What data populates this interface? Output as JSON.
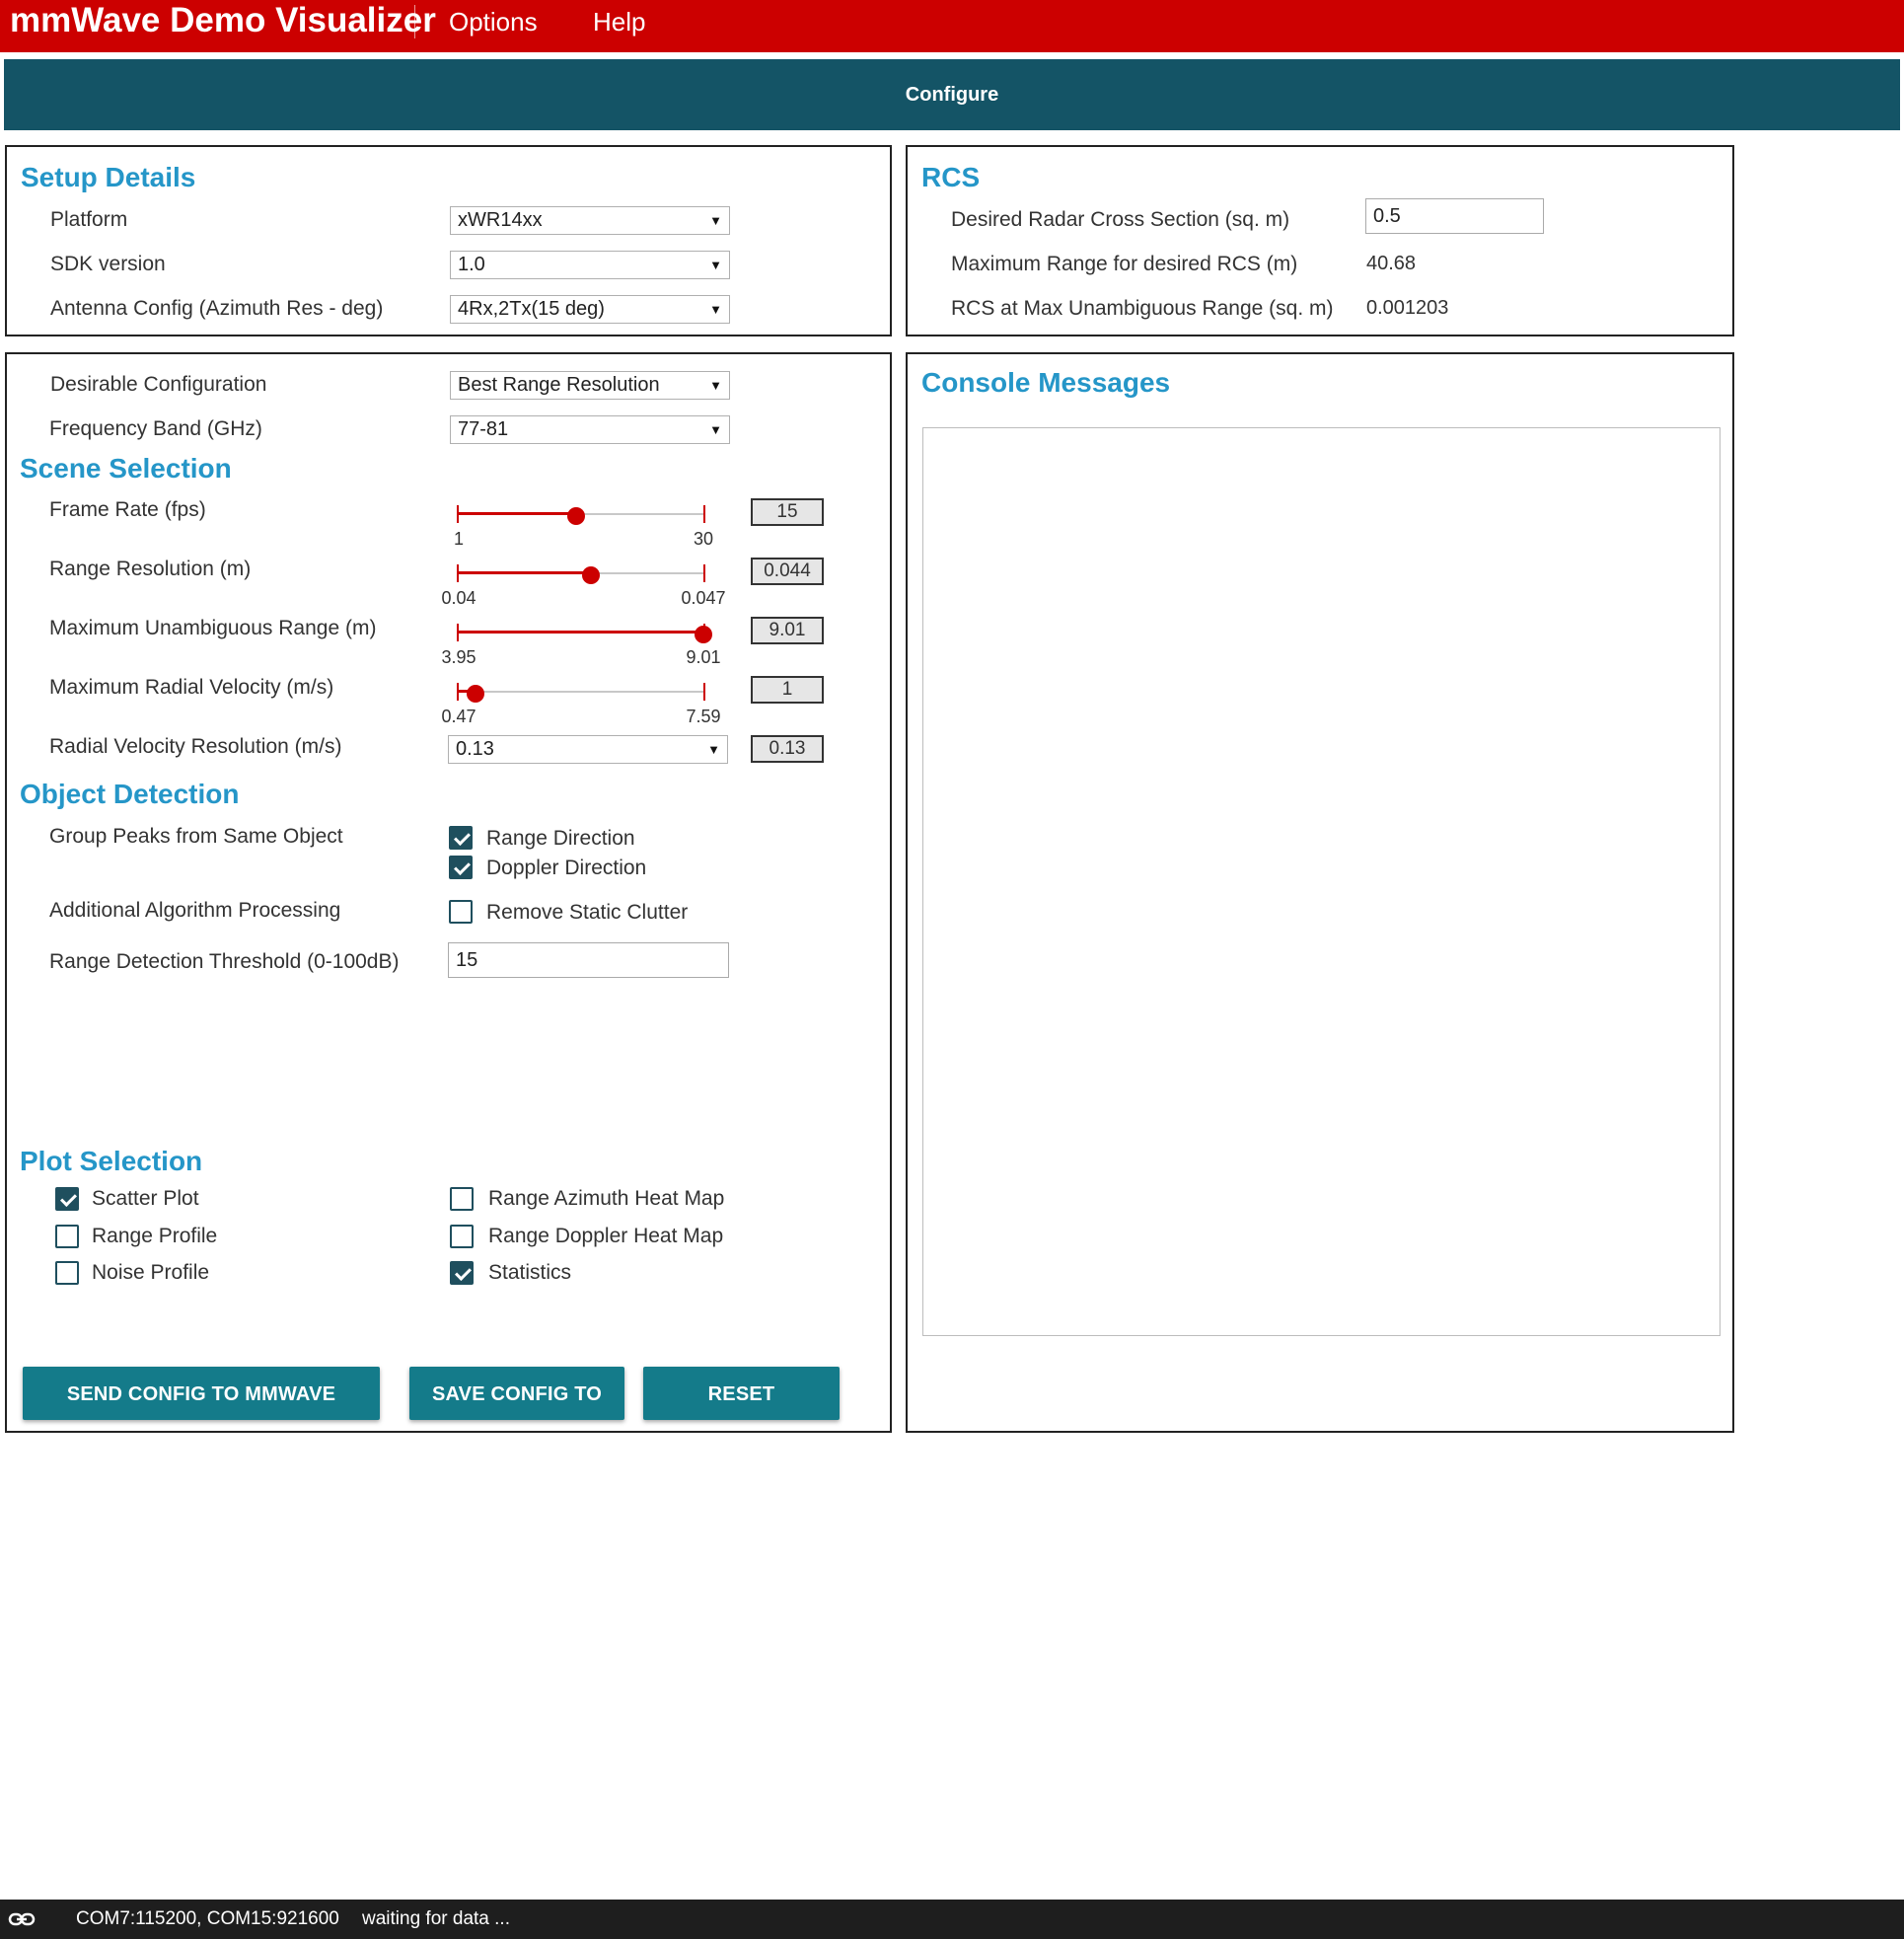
{
  "app": {
    "title": "mmWave Demo Visualizer"
  },
  "menu": {
    "options": "Options",
    "help": "Help"
  },
  "tabs": {
    "configure": "Configure"
  },
  "setup": {
    "heading": "Setup Details",
    "platform_label": "Platform",
    "platform_value": "xWR14xx",
    "sdk_label": "SDK version",
    "sdk_value": "1.0",
    "antenna_label": "Antenna Config (Azimuth Res - deg)",
    "antenna_value": "4Rx,2Tx(15 deg)"
  },
  "rcs": {
    "heading": "RCS",
    "desired_label": "Desired Radar Cross Section (sq. m)",
    "desired_value": "0.5",
    "max_range_label": "Maximum Range for desired RCS (m)",
    "max_range_value": "40.68",
    "rcs_at_max_label": "RCS at Max Unambiguous Range (sq. m)",
    "rcs_at_max_value": "0.001203"
  },
  "config": {
    "desirable_label": "Desirable Configuration",
    "desirable_value": "Best Range Resolution",
    "freq_label": "Frequency Band (GHz)",
    "freq_value": "77-81"
  },
  "scene": {
    "heading": "Scene Selection",
    "frame_rate": {
      "label": "Frame Rate (fps)",
      "min": "1",
      "max": "30",
      "value": "15",
      "fraction": 0.48
    },
    "range_res": {
      "label": "Range Resolution (m)",
      "min": "0.04",
      "max": "0.047",
      "value": "0.044",
      "fraction": 0.54
    },
    "max_range": {
      "label": "Maximum Unambiguous Range (m)",
      "min": "3.95",
      "max": "9.01",
      "value": "9.01",
      "fraction": 1.0
    },
    "max_vel": {
      "label": "Maximum Radial Velocity (m/s)",
      "min": "0.47",
      "max": "7.59",
      "value": "1",
      "fraction": 0.07
    },
    "vel_res": {
      "label": "Radial Velocity Resolution (m/s)",
      "select_value": "0.13",
      "value": "0.13"
    }
  },
  "detection": {
    "heading": "Object Detection",
    "group_label": "Group Peaks from Same Object",
    "range_dir": "Range Direction",
    "range_dir_checked": true,
    "doppler_dir": "Doppler Direction",
    "doppler_dir_checked": true,
    "algo_label": "Additional Algorithm Processing",
    "static_clutter": "Remove Static Clutter",
    "static_clutter_checked": false,
    "threshold_label": "Range Detection Threshold (0-100dB)",
    "threshold_value": "15"
  },
  "plots": {
    "heading": "Plot Selection",
    "scatter": "Scatter Plot",
    "scatter_checked": true,
    "range_profile": "Range Profile",
    "range_profile_checked": false,
    "noise_profile": "Noise Profile",
    "noise_profile_checked": false,
    "range_azimuth": "Range Azimuth Heat Map",
    "range_azimuth_checked": false,
    "range_doppler": "Range Doppler Heat Map",
    "range_doppler_checked": false,
    "statistics": "Statistics",
    "statistics_checked": true
  },
  "buttons": {
    "send": "SEND CONFIG TO MMWAVE DEVICE",
    "save": "SAVE CONFIG TO PC",
    "reset": "RESET SELECTION"
  },
  "console": {
    "heading": "Console Messages"
  },
  "status": {
    "ports": "COM7:115200, COM15:921600",
    "message": "waiting for data ..."
  },
  "colors": {
    "brand_red": "#cc0000",
    "tab_teal": "#145466",
    "button_teal": "#147b8a",
    "heading_blue": "#2596c8"
  },
  "icons": {
    "status_link": "link-icon",
    "dropdown": "chevron-down-icon"
  }
}
